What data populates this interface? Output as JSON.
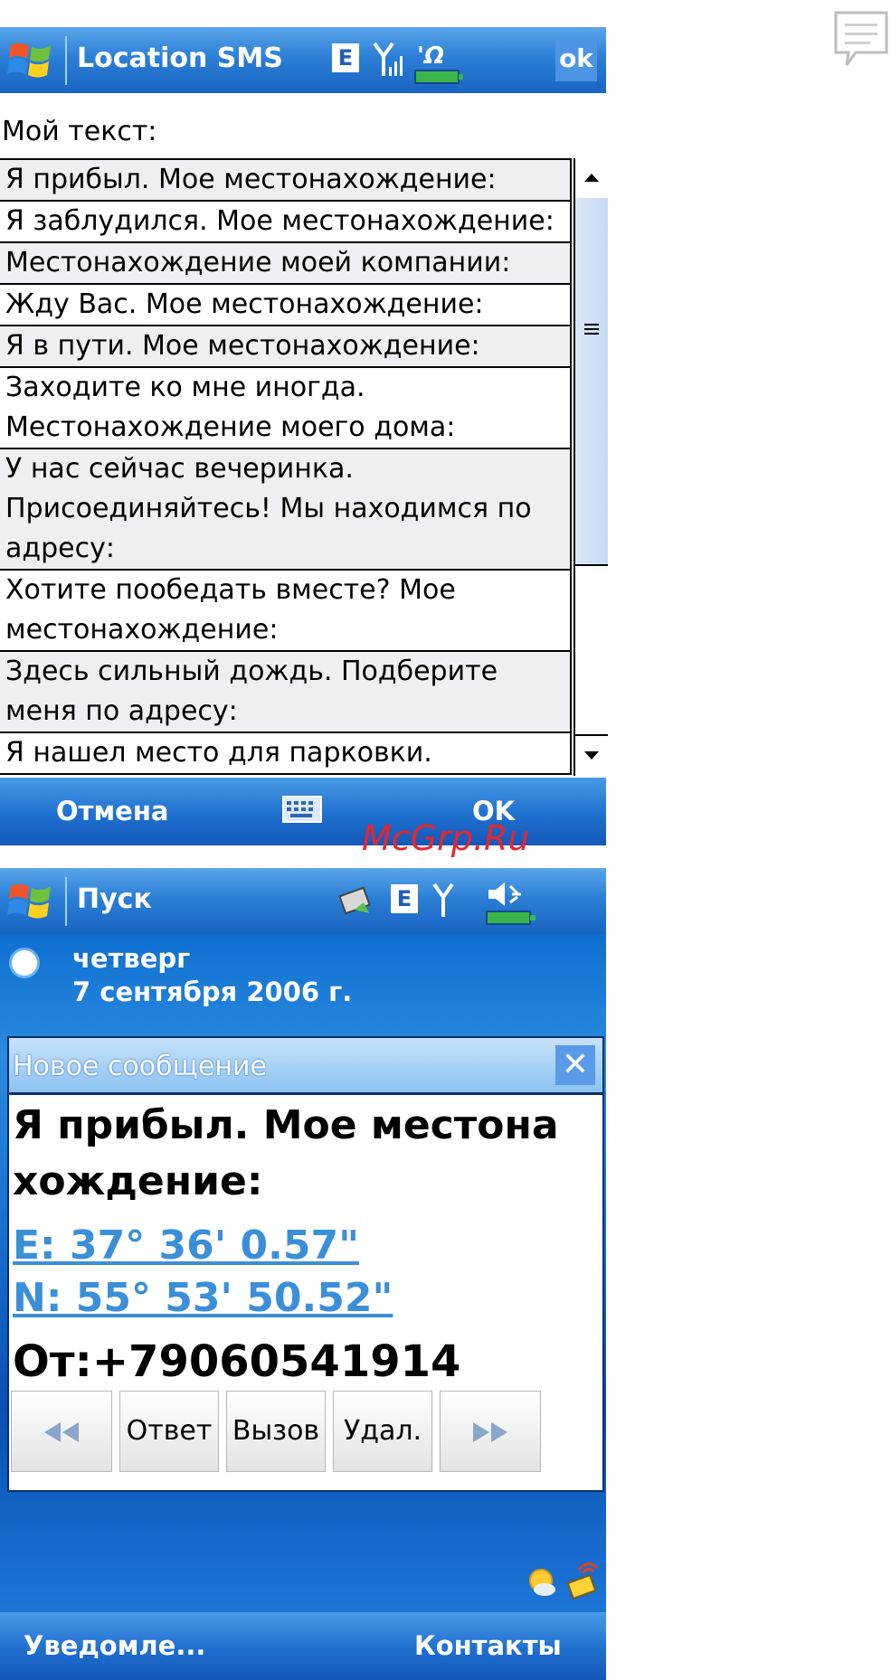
{
  "screen1": {
    "title": "Location SMS",
    "network_label": "E",
    "ok_label": "ok",
    "field_label": "Мой текст:",
    "items": [
      "Я прибыл. Мое местонахождение:",
      "Я заблудился. Мое местонахождение:",
      "Местонахождение моей компании:",
      "Жду Вас. Мое местонахождение:",
      "Я в пути. Мое местонахождение:",
      "Заходите ко мне иногда.\nМестонахождение моего дома:",
      "У нас сейчас вечеринка.\nПрисоединяйтесь! Мы находимся по\nадресу:",
      "Хотите пообедать вместе? Мое\nместонахождение:",
      "Здесь сильный дождь. Подберите\nменя по адресу:",
      "Я нашел место для парковки."
    ],
    "softkey_left": "Отмена",
    "softkey_right": "OK"
  },
  "watermark": "McGrp.Ru",
  "screen2": {
    "title": "Пуск",
    "network_label": "E",
    "day": "четверг",
    "date": "7 сентября 2006 г.",
    "notification": {
      "title": "Новое сообщение",
      "close_label": "✕",
      "message": "Я прибыл. Мое местона\nхождение:",
      "coord_e": "E: 37° 36'  0.57\"",
      "coord_n": "N: 55° 53' 50.52\"",
      "from": "От:+79060541914",
      "buttons": {
        "reply": "Ответ",
        "call": "Вызов",
        "delete": "Удал."
      }
    },
    "softkey_left": "Уведомле...",
    "softkey_right": "Контакты"
  },
  "colors": {
    "title_bar": "#2c7fd6",
    "link": "#3a8fd8",
    "watermark": "#e5262d"
  }
}
